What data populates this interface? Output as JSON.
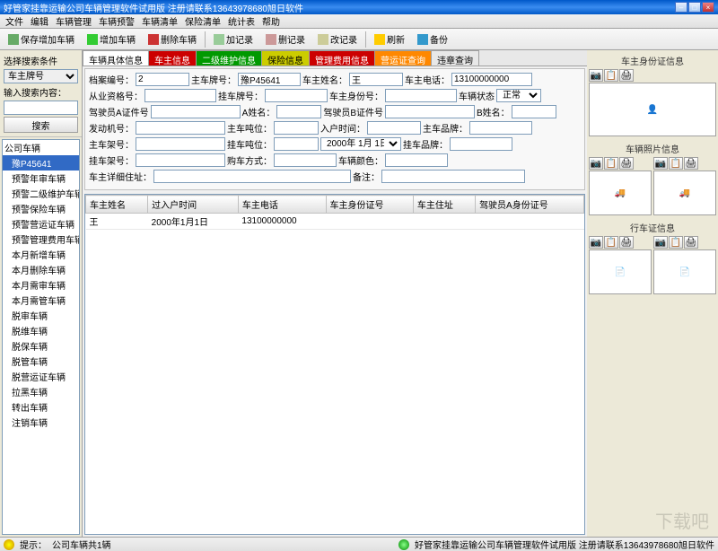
{
  "title": "好管家挂靠运输公司车辆管理软件试用版  注册请联系13643978680旭日软件",
  "menus": [
    "文件",
    "编辑",
    "车辆管理",
    "车辆预警",
    "车辆清单",
    "保险清单",
    "统计表",
    "帮助"
  ],
  "toolbar": {
    "save_add": "保存增加车辆",
    "add": "增加车辆",
    "del": "删除车辆",
    "add_rec": "加记录",
    "del_rec": "删记录",
    "mod_rec": "改记录",
    "refresh": "刷新",
    "backup": "备份"
  },
  "search": {
    "title": "选择搜索条件",
    "field": "车主牌号",
    "hint": "输入搜索内容：",
    "btn": "搜索"
  },
  "tree": {
    "root": "公司车辆",
    "items": [
      "豫P45641",
      "预警年审车辆",
      "预警二级维护车辆",
      "预警保险车辆",
      "预警营运证车辆",
      "预警管理费用车辆",
      "本月新增车辆",
      "本月删除车辆",
      "本月需审车辆",
      "本月需管车辆",
      "脱审车辆",
      "脱维车辆",
      "脱保车辆",
      "脱管车辆",
      "脱营运证车辆",
      "拉黑车辆",
      "转出车辆",
      "注销车辆"
    ]
  },
  "tabs": [
    "车辆具体信息",
    "车主信息",
    "二级维护信息",
    "保险信息",
    "管理费用信息",
    "营运证查询",
    "违章查询"
  ],
  "form": {
    "labels": {
      "archive": "档案编号：",
      "plate": "主车牌号：",
      "owner": "车主姓名：",
      "phone": "车主电话：",
      "qual": "从业资格号：",
      "trailer_plate": "挂车牌号：",
      "owner_id": "车主身份号：",
      "status": "车辆状态",
      "driverA": "驾驶员A证件号",
      "nameA": "A姓名：",
      "driverB": "驾驶员B证件号",
      "nameB": "B姓名：",
      "engine": "发动机号：",
      "main_tons": "主车吨位：",
      "enter_time": "入户时间：",
      "main_brand": "主车品牌：",
      "main_frame": "主车架号：",
      "trailer_tons": "挂车吨位：",
      "trailer_brand": "挂车品牌：",
      "trailer_frame": "挂车架号：",
      "buy_method": "购车方式：",
      "color": "车辆颜色：",
      "addr": "车主详细住址：",
      "remark": "备注："
    },
    "values": {
      "archive": "2",
      "plate": "豫P45641",
      "owner": "王",
      "phone": "13100000000",
      "status": "正常",
      "enter_date": "2000年 1月 1日"
    }
  },
  "grid": {
    "cols": [
      "车主姓名",
      "过入户时间",
      "车主电话",
      "车主身份证号",
      "车主住址",
      "驾驶员A身份证号"
    ],
    "row": {
      "owner": "王",
      "date": "2000年1月1日",
      "phone": "13100000000"
    }
  },
  "panels": {
    "owner": "车主身份证信息",
    "photo": "车辆照片信息",
    "license": "行车证信息"
  },
  "status": {
    "hint": "提示：",
    "msg": "公司车辆共1辆",
    "right": "好管家挂靠运输公司车辆管理软件试用版  注册请联系13643978680旭日软件"
  },
  "watermark": "下载吧"
}
